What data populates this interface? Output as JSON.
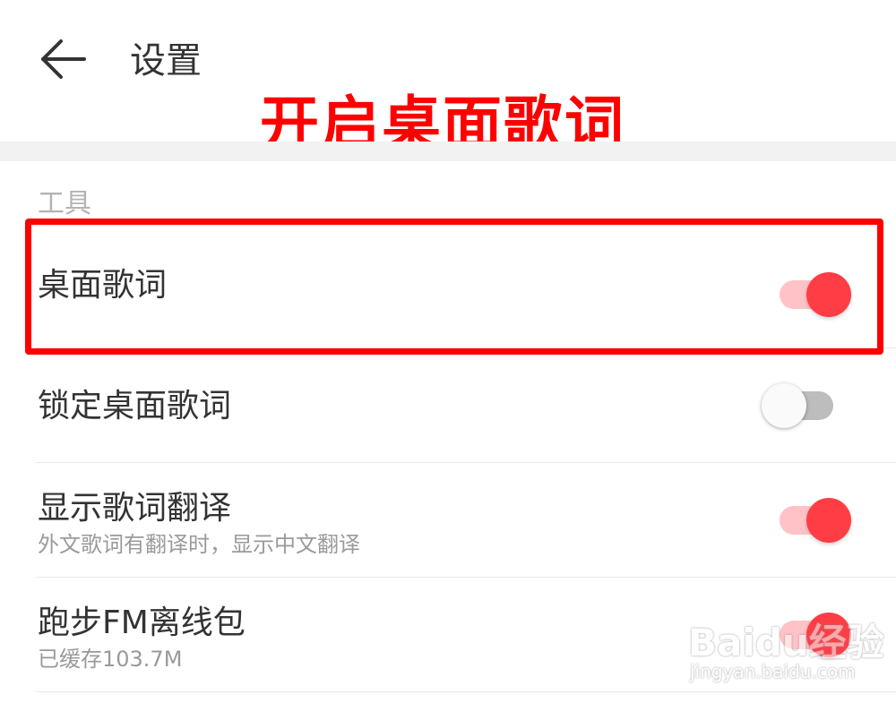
{
  "header": {
    "title": "设置",
    "back_icon": "arrow-left-icon"
  },
  "annotation": {
    "banner_text": "开启桌面歌词",
    "color": "#ff0000"
  },
  "section": {
    "label": "工具"
  },
  "settings": [
    {
      "title": "桌面歌词",
      "subtitle": "",
      "enabled": true
    },
    {
      "title": "锁定桌面歌词",
      "subtitle": "",
      "enabled": false
    },
    {
      "title": "显示歌词翻译",
      "subtitle": "外文歌词有翻译时，显示中文翻译",
      "enabled": true
    },
    {
      "title": "跑步FM离线包",
      "subtitle": "已缓存103.7M",
      "enabled": true
    }
  ],
  "watermark": {
    "brand": "Baidu经验",
    "url": "jingyan.baidu.com"
  },
  "colors": {
    "accent": "#ff3d45",
    "accent_track": "#ffc2c6",
    "off_track": "#bdbdbd",
    "section_label": "#b3b3b3"
  }
}
